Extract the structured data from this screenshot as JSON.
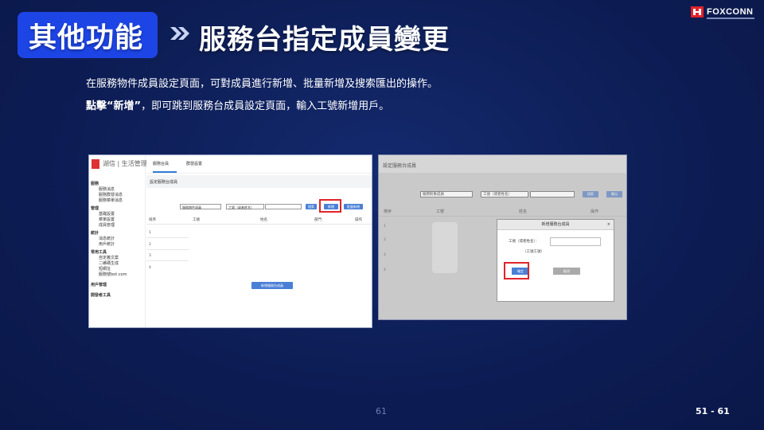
{
  "header": {
    "badge_label": "其他功能",
    "title": "服務台指定成員變更",
    "logo_text": "FOXCONN"
  },
  "description": {
    "line1": "在服務物件成員設定頁面，可對成員進行新增、批量新增及搜索匯出的操作。",
    "line2_bold": "點擊“新增”",
    "line2_rest": "，即可跳到服務台成員設定頁面，輸入工號新增用戶。"
  },
  "screenshot1": {
    "brand": "湖信 | 生活管理",
    "tab_active": "服務台員",
    "tab_second": "群發設置",
    "breadcrumb": "設定服務台成員",
    "select1": "服務物件成員",
    "select2": "工號（或者姓名）",
    "btn_search": "搜索",
    "btn_add": "新增",
    "btn_batch": "批量新增",
    "columns": [
      "排序",
      "工號",
      "姓名",
      "部門",
      "操作"
    ],
    "rows": [
      "1",
      "2",
      "3",
      "4"
    ],
    "btn_add_member": "新增服務台成員",
    "menu_groups": [
      {
        "group": "服務",
        "items": [
          "服務消息",
          "服務群發消息",
          "服務菜單消息"
        ]
      },
      {
        "group": "管理",
        "items": [
          "基礎設置",
          "菜單設置",
          "成員管理"
        ]
      },
      {
        "group": "統計",
        "items": [
          "消息統計",
          "用戶統計"
        ]
      },
      {
        "group": "常用工具",
        "items": [
          "自定義文案",
          "二維碼生成",
          "短網址",
          "服務號bot.com"
        ]
      }
    ],
    "menu_bottom": [
      "用戶管理",
      "開發者工具"
    ]
  },
  "screenshot2": {
    "header": "設定服務台成員",
    "select1": "服務對象成員",
    "select2": "工號（或者姓名）",
    "btn_search": "搜索",
    "btn_export": "匯出",
    "columns": [
      "排序",
      "工號",
      "姓名",
      "操作"
    ],
    "rows": [
      "1",
      "2",
      "3",
      "4"
    ],
    "dialog_title": "新增服務台成員",
    "dialog_close": "×",
    "dialog_label": "工號（或者姓名）：",
    "dialog_hint": "（工號工號）",
    "dialog_confirm": "確定",
    "dialog_cancel": "取消"
  },
  "footer": {
    "page_center": "61",
    "page_right": "51 - 61"
  },
  "colors": {
    "background": "#0d1d55",
    "badge": "#1d45e6",
    "highlight": "#e0242b",
    "button": "#4a7fd6"
  }
}
